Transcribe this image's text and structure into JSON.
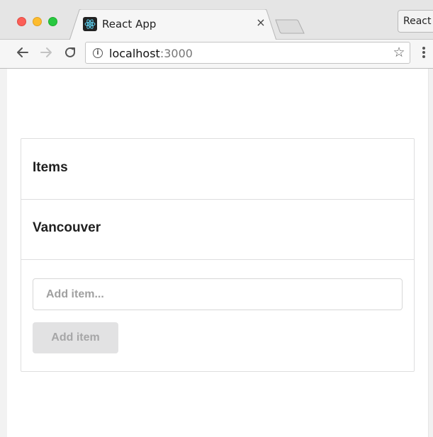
{
  "browser": {
    "tab_title": "React App",
    "tab_close": "×",
    "profile_label": "React",
    "url_host": "localhost",
    "url_port": ":3000",
    "info_icon": "i",
    "star_icon": "☆"
  },
  "app": {
    "sections": [
      {
        "heading": "Items"
      },
      {
        "heading": "Vancouver"
      }
    ],
    "input": {
      "placeholder": "Add item...",
      "value": ""
    },
    "add_button_label": "Add item"
  },
  "colors": {
    "close": "#fc5f57",
    "minimize": "#fdbc2e",
    "maximize": "#28c840",
    "button_bg": "#e2e2e3",
    "button_text": "#a6a6a7",
    "border": "#dededf"
  },
  "icons": [
    "close-window-icon",
    "minimize-window-icon",
    "maximize-window-icon",
    "react-favicon-icon",
    "back-arrow-icon",
    "forward-arrow-icon",
    "reload-icon",
    "info-icon",
    "star-icon",
    "menu-dots-icon"
  ]
}
